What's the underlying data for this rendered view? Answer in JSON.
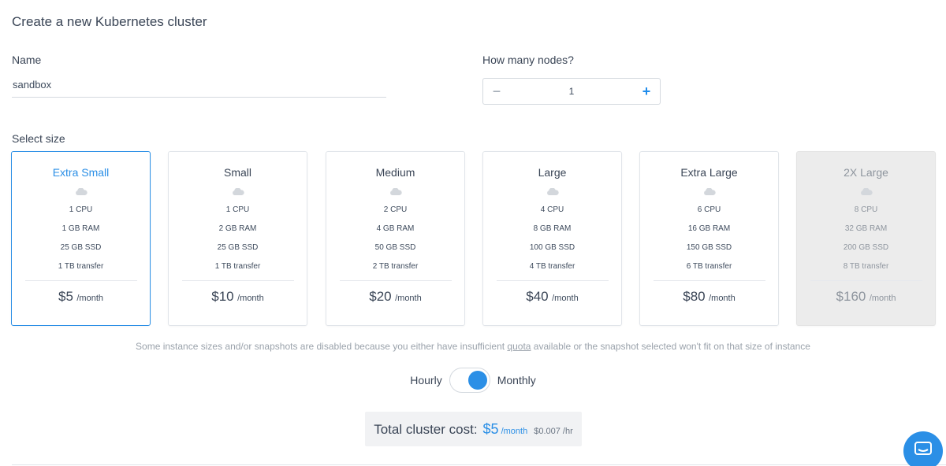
{
  "page": {
    "title": "Create a new Kubernetes cluster"
  },
  "name_field": {
    "label": "Name",
    "value": "sandbox"
  },
  "nodes": {
    "label": "How many nodes?",
    "value": "1",
    "minus": "−",
    "plus": "+"
  },
  "size": {
    "label": "Select size",
    "cards": [
      {
        "name": "Extra Small",
        "cpu": "1 CPU",
        "ram": "1 GB RAM",
        "ssd": "25 GB SSD",
        "transfer": "1 TB transfer",
        "price": "$5",
        "per": "/month",
        "state": "selected"
      },
      {
        "name": "Small",
        "cpu": "1 CPU",
        "ram": "2 GB RAM",
        "ssd": "25 GB SSD",
        "transfer": "1 TB transfer",
        "price": "$10",
        "per": "/month",
        "state": "normal"
      },
      {
        "name": "Medium",
        "cpu": "2 CPU",
        "ram": "4 GB RAM",
        "ssd": "50 GB SSD",
        "transfer": "2 TB transfer",
        "price": "$20",
        "per": "/month",
        "state": "normal"
      },
      {
        "name": "Large",
        "cpu": "4 CPU",
        "ram": "8 GB RAM",
        "ssd": "100 GB SSD",
        "transfer": "4 TB transfer",
        "price": "$40",
        "per": "/month",
        "state": "normal"
      },
      {
        "name": "Extra Large",
        "cpu": "6 CPU",
        "ram": "16 GB RAM",
        "ssd": "150 GB SSD",
        "transfer": "6 TB transfer",
        "price": "$80",
        "per": "/month",
        "state": "normal"
      },
      {
        "name": "2X Large",
        "cpu": "8 CPU",
        "ram": "32 GB RAM",
        "ssd": "200 GB SSD",
        "transfer": "8 TB transfer",
        "price": "$160",
        "per": "/month",
        "state": "disabled"
      }
    ]
  },
  "note": {
    "before": "Some instance sizes and/or snapshots are disabled because you either have insufficient ",
    "link": "quota",
    "after": " available or the snapshot selected won't fit on that size of instance"
  },
  "billing": {
    "left_label": "Hourly",
    "right_label": "Monthly",
    "selected": "Monthly"
  },
  "total": {
    "label": "Total cluster cost:",
    "price": "$5",
    "per": "/month",
    "hourly": "$0.007 /hr"
  },
  "colors": {
    "accent": "#2b8fe6",
    "disabled_bg": "#ececec",
    "text": "#3a4556"
  },
  "icons": {
    "size_card": "cloud-icon",
    "chat": "chat-icon"
  }
}
